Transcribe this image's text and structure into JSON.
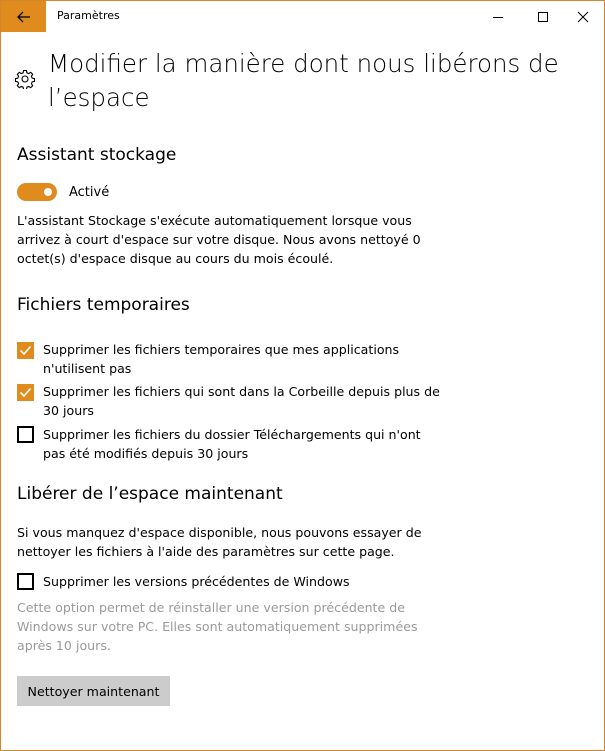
{
  "window": {
    "title": "Paramètres",
    "accent_color": "#e08b1e"
  },
  "header": {
    "title_line1": "Modifier la manière dont nous libérons de",
    "title_line2": "l’espace",
    "icon": "gear-icon"
  },
  "storage_sense": {
    "heading": "Assistant stockage",
    "toggle_state": "on",
    "toggle_label": "Activé",
    "description": [
      "L'assistant Stockage s'exécute automatiquement lorsque vous",
      "arrivez à court d'espace sur votre disque. Nous avons nettoyé 0",
      "octet(s) d'espace disque au cours du mois écoulé."
    ]
  },
  "temp_files": {
    "heading": "Fichiers temporaires",
    "options": [
      {
        "checked": true,
        "lines": [
          "Supprimer les fichiers temporaires que mes applications",
          "n'utilisent pas"
        ]
      },
      {
        "checked": true,
        "lines": [
          "Supprimer les fichiers qui sont dans la Corbeille depuis plus de",
          "30 jours"
        ]
      },
      {
        "checked": false,
        "lines": [
          "Supprimer les fichiers du dossier Téléchargements qui n'ont",
          "pas été modifiés depuis 30 jours"
        ]
      }
    ]
  },
  "free_now": {
    "heading": "Libérer de l’espace maintenant",
    "description": [
      "Si vous manquez d'espace disponible, nous pouvons essayer de",
      "nettoyer les fichiers à l'aide des paramètres sur cette page."
    ],
    "option": {
      "checked": false,
      "label": "Supprimer les versions précédentes de Windows"
    },
    "note": [
      "Cette option permet de réinstaller une version précédente de",
      "Windows sur votre PC. Elles sont automatiquement supprimées",
      "après 10 jours."
    ],
    "button_label": "Nettoyer maintenant"
  }
}
